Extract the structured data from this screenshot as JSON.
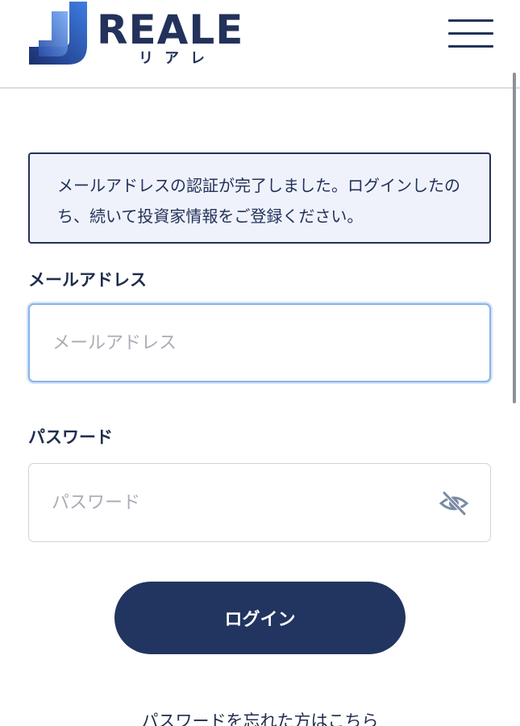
{
  "header": {
    "brand_name": "REALE",
    "brand_kana": "リアレ",
    "menu_icon": "hamburger-menu-icon",
    "brand_colors": [
      "#1e3b8a",
      "#3f7fe6",
      "#6fa6f5"
    ]
  },
  "notice": {
    "message": "メールアドレスの認証が完了しました。ログインしたのち、続いて投資家情報をご登録ください。"
  },
  "form": {
    "email": {
      "label": "メールアドレス",
      "placeholder": "メールアドレス",
      "value": ""
    },
    "password": {
      "label": "パスワード",
      "placeholder": "パスワード",
      "value": "",
      "toggle_icon": "eye-slash-icon"
    },
    "login_label": "ログイン",
    "forgot_password_label": "パスワードを忘れた方はこちら"
  },
  "colors": {
    "primary": "#213560",
    "notice_background": "#f0f2fb",
    "focus_ring": "#88b3ea"
  }
}
